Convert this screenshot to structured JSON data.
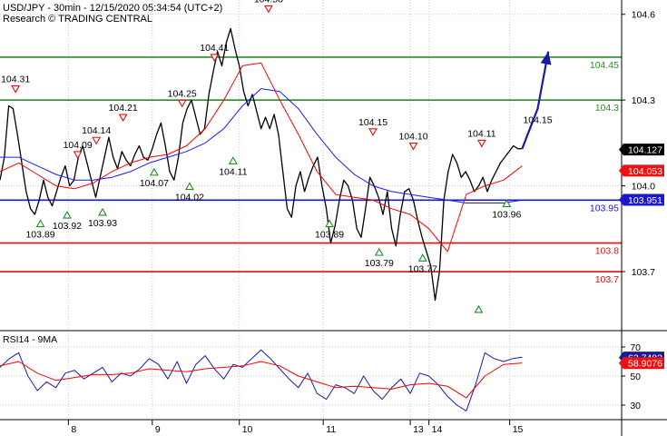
{
  "header": {
    "title": "USD/JPY - 30min - 12/15/2020 05:34:54 (UTC+2)",
    "subtitle": "Research © TRADING CENTRAL"
  },
  "chart_data": [
    {
      "type": "line",
      "panel": "price",
      "ylim": [
        103.5,
        104.65
      ],
      "yticks": [
        "104.6",
        "104.3",
        "104.0",
        "103.7"
      ],
      "xlim": [
        0,
        100
      ],
      "xticks": [
        {
          "x": 11,
          "label": "8"
        },
        {
          "x": 24.5,
          "label": "9"
        },
        {
          "x": 38.5,
          "label": "10"
        },
        {
          "x": 52,
          "label": "11"
        },
        {
          "x": 66,
          "label": "13"
        },
        {
          "x": 69,
          "label": "14"
        },
        {
          "x": 82,
          "label": "15"
        }
      ],
      "grid": "dotted",
      "series": [
        {
          "role": "price",
          "color": "#000000",
          "x": [
            0,
            0.7,
            1.4,
            2.1,
            2.8,
            3.5,
            4.2,
            4.9,
            5.6,
            6.3,
            7.0,
            7.7,
            8.4,
            9.1,
            9.8,
            10.5,
            11.2,
            11.9,
            12.6,
            13.3,
            14.0,
            14.7,
            15.4,
            16.1,
            16.8,
            17.5,
            18.2,
            18.9,
            19.6,
            20.3,
            21.0,
            21.7,
            22.4,
            23.1,
            23.8,
            24.5,
            25.2,
            25.9,
            26.6,
            27.3,
            28.0,
            28.7,
            29.4,
            30.1,
            30.8,
            31.5,
            32.2,
            32.9,
            33.6,
            34.3,
            35.0,
            35.7,
            36.4,
            37.1,
            37.8,
            38.5,
            39.2,
            39.9,
            40.6,
            41.3,
            42.0,
            42.7,
            43.4,
            44.1,
            44.8,
            45.5,
            46.2,
            46.9,
            47.6,
            48.3,
            49.0,
            49.7,
            50.4,
            51.1,
            51.8,
            52.5,
            53.2,
            53.9,
            54.6,
            55.3,
            56.0,
            56.7,
            57.4,
            58.1,
            58.8,
            59.5,
            60.2,
            60.9,
            61.6,
            62.3,
            63.0,
            63.7,
            64.4,
            65.1,
            65.8,
            66.5,
            67.2,
            67.9,
            68.6,
            69.3,
            70.0,
            70.7,
            71.4,
            72.1,
            72.8,
            73.5,
            74.2,
            74.9,
            75.6,
            76.3,
            77.0,
            77.7,
            78.4,
            79.1,
            79.8,
            80.5,
            81.2,
            81.9,
            82.6,
            83.3,
            84.0
          ],
          "values": [
            104.02,
            104.1,
            104.28,
            104.27,
            104.18,
            104.08,
            103.98,
            103.92,
            103.9,
            103.95,
            104.02,
            103.96,
            103.93,
            103.98,
            104.03,
            104.07,
            104.0,
            104.02,
            104.1,
            104.14,
            104.08,
            104.02,
            103.96,
            104.03,
            104.1,
            104.17,
            104.1,
            104.06,
            104.12,
            104.09,
            104.07,
            104.11,
            104.14,
            104.1,
            104.09,
            104.13,
            104.18,
            104.22,
            104.14,
            104.05,
            104.02,
            104.1,
            104.22,
            104.27,
            104.3,
            104.24,
            104.18,
            104.2,
            104.32,
            104.4,
            104.47,
            104.42,
            104.5,
            104.55,
            104.48,
            104.42,
            104.33,
            104.28,
            104.32,
            104.26,
            104.2,
            104.24,
            104.2,
            104.25,
            104.18,
            104.05,
            103.92,
            103.89,
            104.0,
            104.05,
            103.98,
            104.03,
            104.07,
            104.1,
            104.0,
            103.92,
            103.8,
            103.86,
            103.95,
            104.02,
            104.0,
            103.95,
            103.85,
            103.82,
            103.92,
            104.03,
            104.0,
            103.96,
            103.9,
            103.98,
            103.85,
            103.79,
            103.9,
            103.98,
            103.99,
            103.95,
            103.88,
            103.82,
            103.77,
            103.72,
            103.6,
            103.7,
            103.95,
            104.05,
            104.11,
            104.08,
            104.03,
            104.05,
            104.02,
            103.98,
            104.0,
            104.03,
            103.98,
            104.02,
            104.05,
            104.08,
            104.1,
            104.12,
            104.14,
            104.13,
            104.13
          ]
        },
        {
          "role": "moving-average-1",
          "color": "#ff0000",
          "x": [
            0,
            3,
            6,
            9,
            12,
            15,
            18,
            21,
            24,
            27,
            30,
            33,
            36,
            39,
            42,
            45,
            48,
            51,
            54,
            57,
            60,
            63,
            66,
            69,
            72,
            75,
            78,
            81,
            84
          ],
          "values": [
            104.05,
            104.08,
            104.04,
            104.0,
            103.99,
            104.01,
            104.05,
            104.08,
            104.1,
            104.11,
            104.14,
            104.2,
            104.3,
            104.42,
            104.43,
            104.3,
            104.18,
            104.05,
            103.97,
            103.96,
            103.95,
            103.92,
            103.9,
            103.85,
            103.77,
            103.97,
            104.0,
            104.02,
            104.07
          ]
        },
        {
          "role": "moving-average-2",
          "color": "#1a1aff",
          "x": [
            0,
            3,
            6,
            9,
            12,
            15,
            18,
            21,
            24,
            27,
            30,
            33,
            36,
            39,
            42,
            45,
            48,
            51,
            54,
            57,
            60,
            63,
            66,
            69,
            72,
            75,
            78,
            81,
            84
          ],
          "values": [
            104.1,
            104.1,
            104.07,
            104.04,
            104.02,
            104.02,
            104.03,
            104.05,
            104.08,
            104.1,
            104.12,
            104.15,
            104.2,
            104.28,
            104.34,
            104.33,
            104.27,
            104.18,
            104.1,
            104.04,
            104.0,
            103.98,
            103.97,
            103.96,
            103.95,
            103.94,
            103.94,
            103.94,
            103.95
          ]
        },
        {
          "role": "forecast-arrow",
          "color": "#1a1aa8",
          "x": [
            84,
            86.5,
            88.2
          ],
          "values": [
            104.13,
            104.27,
            104.47
          ]
        }
      ],
      "horizontal_lines": [
        {
          "value": 104.45,
          "label": "104.45",
          "color": "#2e8b2e"
        },
        {
          "value": 104.3,
          "label": "104.3",
          "color": "#2e8b2e"
        },
        {
          "value": 103.95,
          "label": "103.95",
          "color": "#1a1acc"
        },
        {
          "value": 103.8,
          "label": "103.8",
          "color": "#e01010"
        },
        {
          "value": 103.7,
          "label": "103.7",
          "color": "#e01010"
        }
      ],
      "price_tags": [
        {
          "value": 104.127,
          "label": "104.127",
          "bg": "#000000",
          "fg": "#ffffff"
        },
        {
          "value": 104.053,
          "label": "104.053",
          "bg": "#ee1111",
          "fg": "#ffffff"
        },
        {
          "value": 103.951,
          "label": "103.951",
          "bg": "#1a1acc",
          "fg": "#ffffff"
        }
      ],
      "markers": [
        {
          "type": "high",
          "x": 2.5,
          "value": 104.34,
          "label": "104.31"
        },
        {
          "type": "high",
          "x": 15.5,
          "value": 104.16,
          "label": "104.14"
        },
        {
          "type": "high",
          "x": 12.5,
          "value": 104.11,
          "label": "104.09"
        },
        {
          "type": "high",
          "x": 19.8,
          "value": 104.24,
          "label": "104.21"
        },
        {
          "type": "high",
          "x": 29.3,
          "value": 104.29,
          "label": "104.25"
        },
        {
          "type": "high",
          "x": 34.5,
          "value": 104.45,
          "label": "104.41"
        },
        {
          "type": "high",
          "x": 43.2,
          "value": 104.62,
          "label": "104.58"
        },
        {
          "type": "high",
          "x": 60.0,
          "value": 104.19,
          "label": "104.15"
        },
        {
          "type": "high",
          "x": 66.5,
          "value": 104.14,
          "label": "104.10"
        },
        {
          "type": "high",
          "x": 77.5,
          "value": 104.15,
          "label": "104.11"
        },
        {
          "type": "low",
          "x": 6.5,
          "value": 103.87,
          "label": "103.89"
        },
        {
          "type": "low",
          "x": 10.8,
          "value": 103.9,
          "label": "103.92"
        },
        {
          "type": "low",
          "x": 16.5,
          "value": 103.91,
          "label": "103.93"
        },
        {
          "type": "low",
          "x": 24.8,
          "value": 104.05,
          "label": "104.07"
        },
        {
          "type": "low",
          "x": 30.5,
          "value": 104.0,
          "label": "104.02"
        },
        {
          "type": "low",
          "x": 37.5,
          "value": 104.09,
          "label": "104.11"
        },
        {
          "type": "low",
          "x": 53.0,
          "value": 103.87,
          "label": "103.89"
        },
        {
          "type": "low",
          "x": 61.0,
          "value": 103.77,
          "label": "103.79"
        },
        {
          "type": "low",
          "x": 68.0,
          "value": 103.75,
          "label": "103.77"
        },
        {
          "type": "low",
          "x": 77.0,
          "value": 103.57,
          "label": ""
        },
        {
          "type": "low",
          "x": 81.5,
          "value": 103.94,
          "label": "103.96"
        }
      ],
      "annotations": [
        {
          "x": 86.5,
          "value": 104.22,
          "label": "104.15"
        }
      ]
    },
    {
      "type": "line",
      "panel": "rsi",
      "title": "RSI14 - 9MA",
      "ylim": [
        20,
        80
      ],
      "yticks": [
        "70",
        "50",
        "30"
      ],
      "xlim": [
        0,
        100
      ],
      "series": [
        {
          "role": "rsi",
          "color": "#1a1aa8",
          "x": [
            0,
            1.5,
            3,
            4.5,
            6,
            7.5,
            9,
            10.5,
            12,
            13.5,
            15,
            16.5,
            18,
            19.5,
            21,
            22.5,
            24,
            25.5,
            27,
            28.5,
            30,
            31.5,
            33,
            34.5,
            36,
            37.5,
            39,
            40.5,
            42,
            43.5,
            45,
            46.5,
            48,
            49.5,
            51,
            52.5,
            54,
            55.5,
            57,
            58.5,
            60,
            61.5,
            63,
            64.5,
            66,
            67.5,
            69,
            70.5,
            72,
            73.5,
            75,
            76.5,
            78,
            79.5,
            81,
            82.5,
            84
          ],
          "values": [
            56,
            62,
            66,
            50,
            40,
            46,
            42,
            52,
            54,
            48,
            52,
            56,
            46,
            52,
            50,
            55,
            62,
            58,
            48,
            60,
            45,
            58,
            64,
            55,
            48,
            58,
            56,
            62,
            68,
            62,
            55,
            48,
            42,
            52,
            38,
            34,
            44,
            42,
            38,
            50,
            40,
            34,
            42,
            48,
            38,
            52,
            50,
            44,
            36,
            30,
            26,
            44,
            66,
            62,
            60,
            62,
            63
          ]
        },
        {
          "role": "rsi-ma",
          "color": "#ff0000",
          "x": [
            0,
            3,
            6,
            9,
            12,
            15,
            18,
            21,
            24,
            27,
            30,
            33,
            36,
            39,
            42,
            45,
            48,
            51,
            54,
            57,
            60,
            63,
            66,
            69,
            72,
            75,
            78,
            81,
            84
          ],
          "values": [
            57,
            60,
            52,
            47,
            49,
            51,
            51,
            52,
            55,
            54,
            53,
            55,
            56,
            57,
            60,
            57,
            50,
            46,
            42,
            43,
            42,
            41,
            44,
            45,
            43,
            35,
            50,
            58,
            59
          ]
        }
      ],
      "price_tags": [
        {
          "value": 62.7482,
          "label": "62.7482",
          "bg": "#1a1a99",
          "fg": "#ffffff"
        },
        {
          "value": 58.9076,
          "label": "58.9076",
          "bg": "#ee1111",
          "fg": "#ffffff"
        }
      ]
    }
  ]
}
